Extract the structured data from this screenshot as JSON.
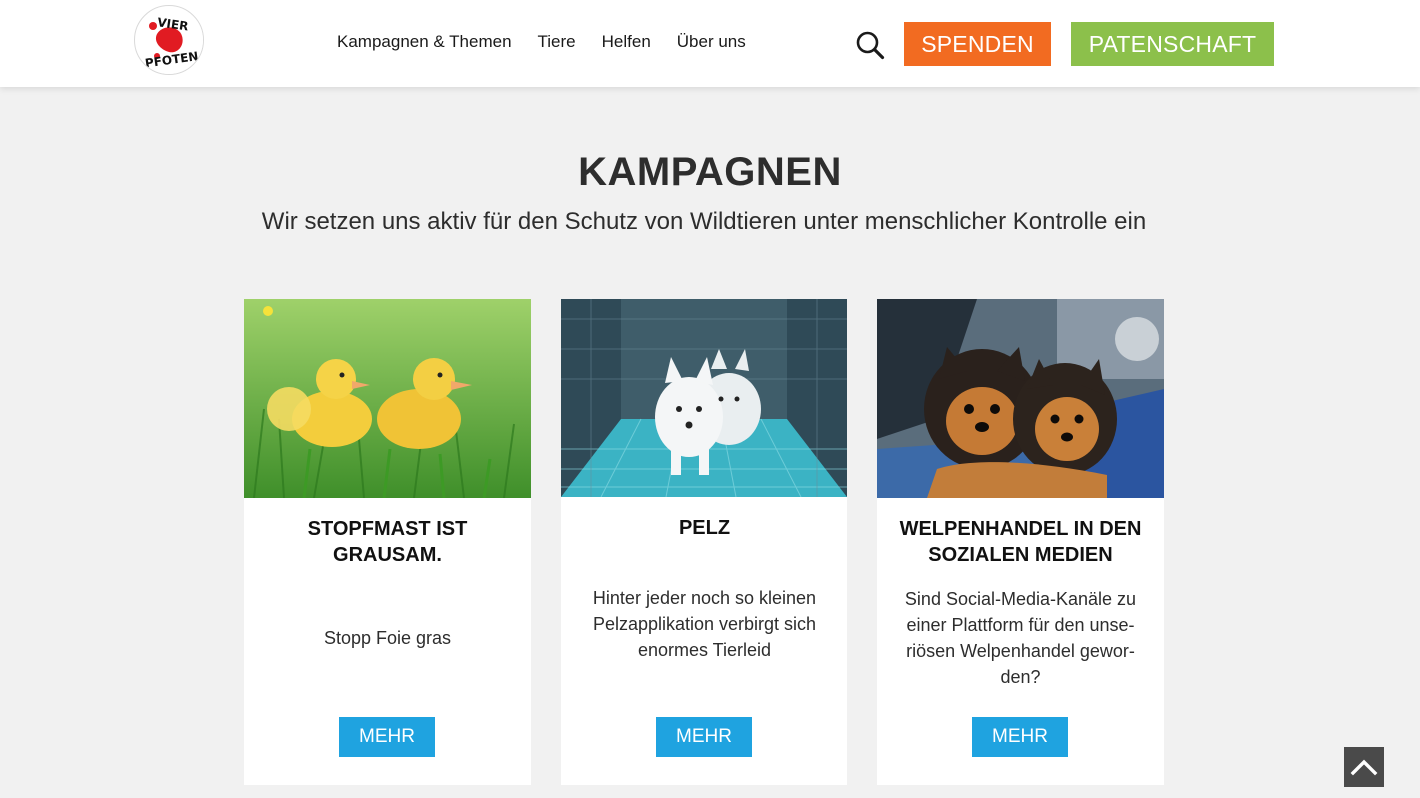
{
  "header": {
    "logo_text": "VIER PFOTEN",
    "nav": [
      {
        "label": "Kampagnen & Themen"
      },
      {
        "label": "Tiere"
      },
      {
        "label": "Helfen"
      },
      {
        "label": "Über uns"
      }
    ],
    "donate_label": "SPENDEN",
    "sponsorship_label": "PATENSCHAFT"
  },
  "colors": {
    "donate": "#f26b21",
    "sponsorship": "#8cc04b",
    "button_blue": "#1fa3e0",
    "page_background": "#f1f1f1"
  },
  "section": {
    "title": "KAMPAGNEN",
    "subtitle": "Wir setzen uns aktiv für den Schutz von Wildtieren unter menschlicher Kontrolle ein"
  },
  "cards": [
    {
      "image": "ducklings-in-grass",
      "title": "STOPFMAST IST GRAUSAM.",
      "text": "Stopp Foie gras",
      "button": "MEHR"
    },
    {
      "image": "white-foxes-in-cage",
      "title": "PELZ",
      "text": "Hinter jeder noch so kleinen Pelzapplikation verbirgt sich enormes Tierleid",
      "button": "MEHR"
    },
    {
      "image": "yorkshire-puppies",
      "title": "WELPENHANDEL IN DEN SOZIALEN MEDIEN",
      "text": "Sind Social-Media-Kanäle zu einer Plattform für den unse-riösen Welpenhandel gewor-den?",
      "button": "MEHR"
    }
  ],
  "icons": {
    "search": "search-icon",
    "back_to_top": "chevron-up-icon"
  }
}
